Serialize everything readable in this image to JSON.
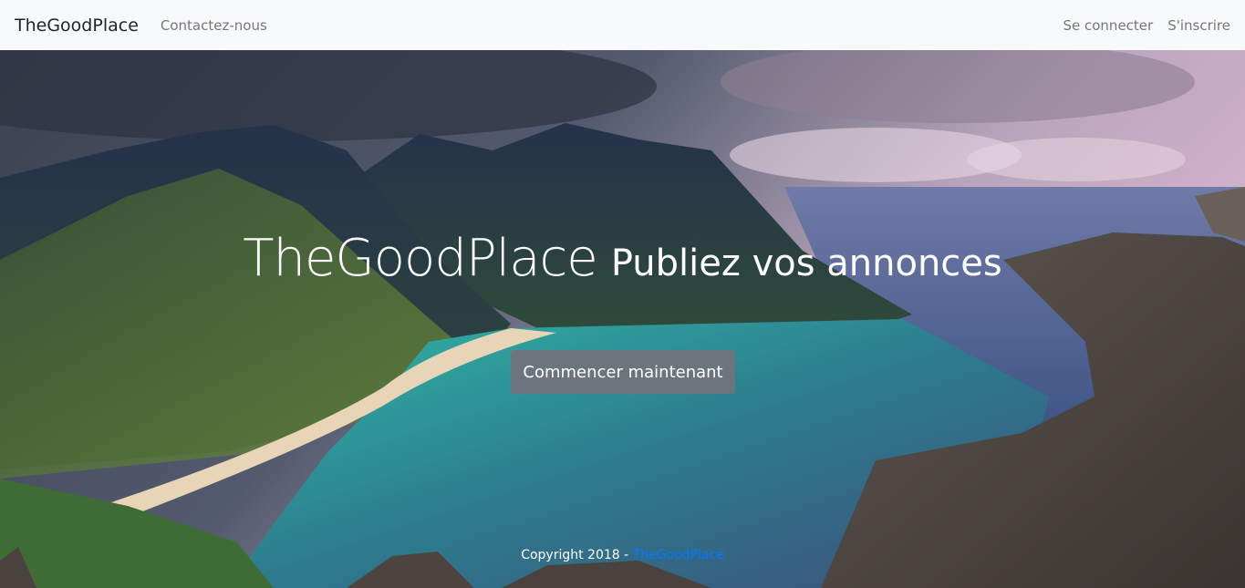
{
  "navbar": {
    "brand": "TheGoodPlace",
    "links": [
      "Contactez-nous"
    ],
    "right_links": [
      "Se connecter",
      "S'inscrire"
    ]
  },
  "hero": {
    "brand": "TheGoodPlace",
    "tagline": "Publiez vos annonces",
    "cta_label": "Commencer maintenant"
  },
  "footer": {
    "copyright": "Copyright 2018 -",
    "link": "TheGoodPlace"
  },
  "colors": {
    "navbar_bg": "#f8f9fa",
    "button_bg": "#6c757d",
    "link": "#007bff"
  }
}
